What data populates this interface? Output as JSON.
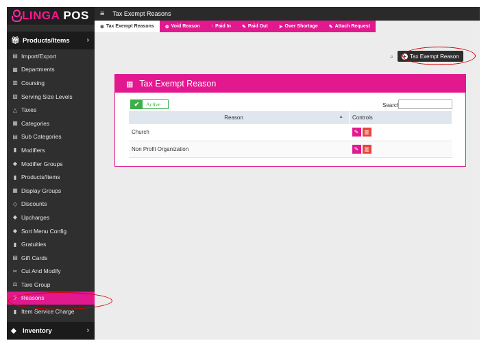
{
  "logo": {
    "part1": "LINGA",
    "part2": "POS"
  },
  "topbar": {
    "menu_icon": "≡",
    "title": "Tax Exempt Reasons"
  },
  "sidebar": {
    "products_section": "Products/Items",
    "inventory_section": "Inventory",
    "items": [
      {
        "label": "Import/Export",
        "icon": "▤"
      },
      {
        "label": "Departments",
        "icon": "▦"
      },
      {
        "label": "Coursing",
        "icon": "▥"
      },
      {
        "label": "Serving Size Levels",
        "icon": "▨"
      },
      {
        "label": "Taxes",
        "icon": "△"
      },
      {
        "label": "Categories",
        "icon": "▦"
      },
      {
        "label": "Sub Categories",
        "icon": "▤"
      },
      {
        "label": "Modifiers",
        "icon": "▮"
      },
      {
        "label": "Modifier Groups",
        "icon": "◆"
      },
      {
        "label": "Products/Items",
        "icon": "▮"
      },
      {
        "label": "Display Groups",
        "icon": "▦"
      },
      {
        "label": "Discounts",
        "icon": "◇"
      },
      {
        "label": "Upcharges",
        "icon": "◆"
      },
      {
        "label": "Sort Menu Config",
        "icon": "◆"
      },
      {
        "label": "Gratuities",
        "icon": "▮"
      },
      {
        "label": "Gift Cards",
        "icon": "▤"
      },
      {
        "label": "Cut And Modify",
        "icon": "✂"
      },
      {
        "label": "Tare Group",
        "icon": "⚖"
      },
      {
        "label": "Reasons",
        "icon": "?"
      },
      {
        "label": "Item Service Charge",
        "icon": "▮"
      }
    ]
  },
  "tabs": [
    {
      "label": "Tax Exempt Reasons",
      "icon": "⊗"
    },
    {
      "label": "Void Reason",
      "icon": "⊗"
    },
    {
      "label": "Paid In",
      "icon": "↑"
    },
    {
      "label": "Paid Out",
      "icon": "✎"
    },
    {
      "label": "Over Shortage",
      "icon": "➤"
    },
    {
      "label": "Attach Request",
      "icon": "✎"
    }
  ],
  "action": {
    "add_label": "Tax Exempt Reason",
    "plus": "+",
    "search_icon": "⌕"
  },
  "panel": {
    "title": "Tax Exempt Reason",
    "table_icon": "▦",
    "active_label": "Active",
    "check": "✔",
    "search_label": "Search",
    "search_value": "",
    "columns": [
      "Reason",
      "Controls"
    ],
    "sort_glyph": "▲",
    "rows": [
      {
        "reason": "Church"
      },
      {
        "reason": "Non Profit Organization"
      }
    ],
    "edit_icon": "✎",
    "delete_icon": "▥"
  },
  "colors": {
    "accent": "#e2188f",
    "sidebar_bg": "#2f2f2f",
    "active_green": "#3bb04a",
    "annotation": "#d40000"
  }
}
